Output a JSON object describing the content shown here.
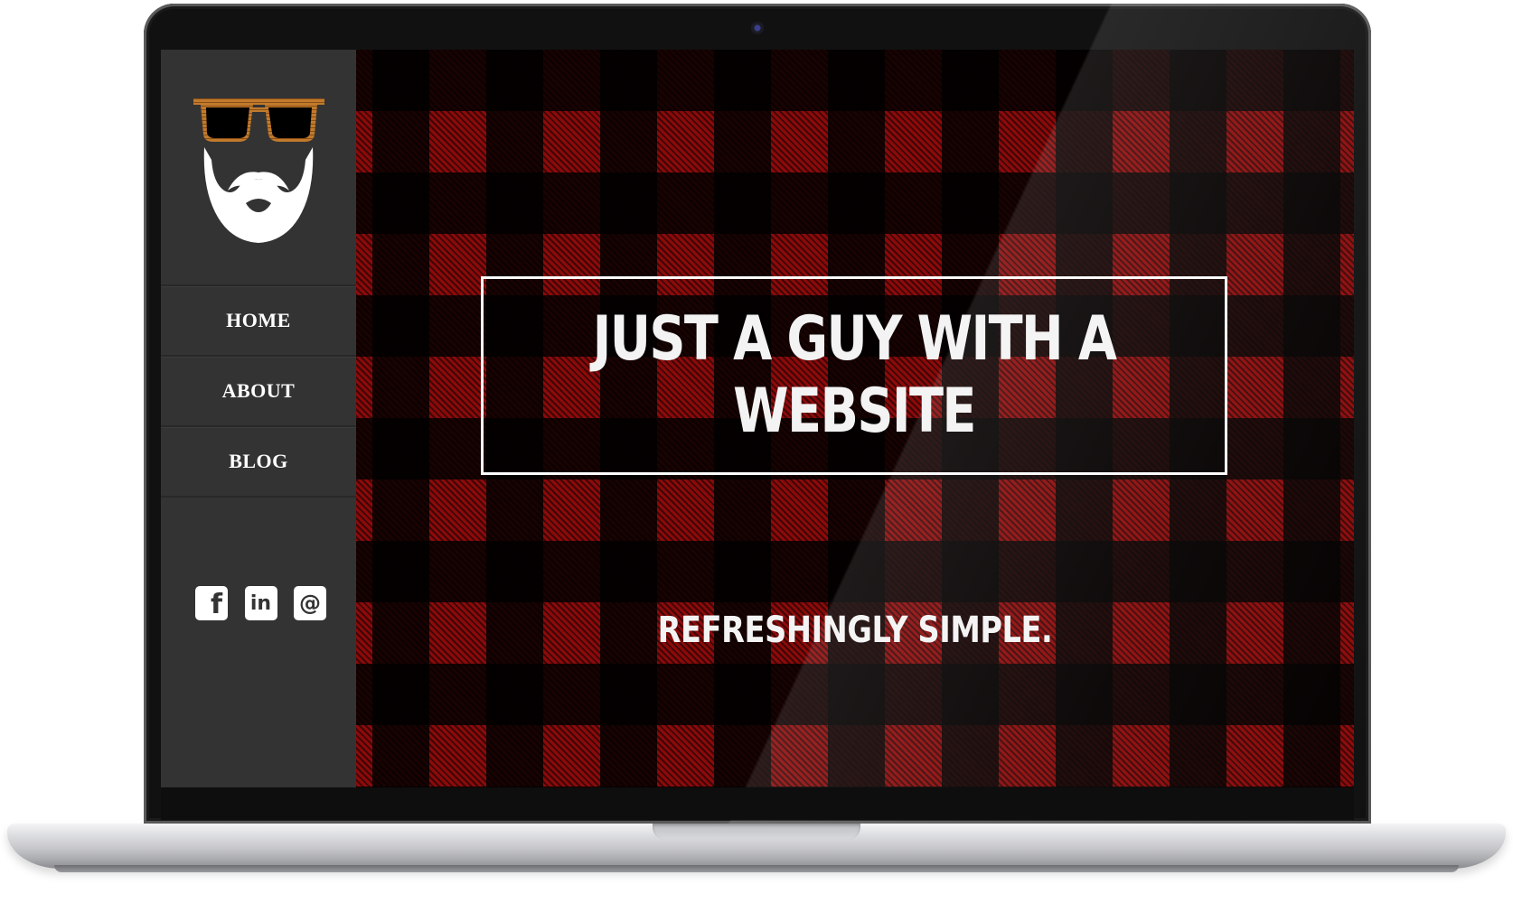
{
  "device": {
    "type": "laptop",
    "camera_icon": "camera-icon"
  },
  "sidebar": {
    "logo_icon": "bearded-man-with-glasses-icon",
    "nav": [
      {
        "label": "HOME"
      },
      {
        "label": "ABOUT"
      },
      {
        "label": "BLOG"
      }
    ],
    "social": [
      {
        "icon": "facebook-icon",
        "glyph": "f"
      },
      {
        "icon": "linkedin-icon",
        "glyph": "in"
      },
      {
        "icon": "email-icon",
        "glyph": "@"
      }
    ]
  },
  "hero": {
    "title": "JUST A GUY WITH A WEBSITE",
    "tagline": "REFRESHINGLY SIMPLE.",
    "background": "red-black-buffalo-plaid"
  },
  "colors": {
    "sidebar_bg": "#333333",
    "plaid_red": "#8c0a0a",
    "plaid_black": "#000000",
    "text": "#ffffff"
  }
}
